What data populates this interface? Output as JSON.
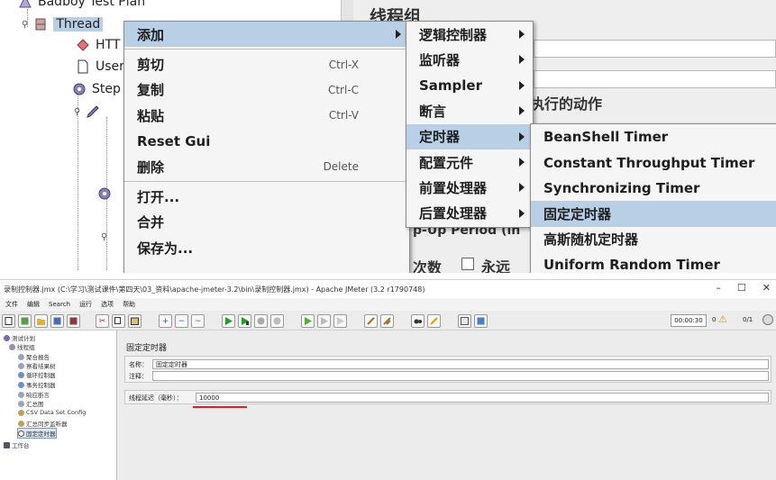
{
  "top": {
    "tree": {
      "plan": "Badboy Test Plan",
      "thread": "Thread",
      "http": "HTT",
      "user": "User",
      "step": "Step"
    },
    "right_title": "线程组",
    "right_action_label": "执行的动作",
    "rampup_label": "p-Up Period (in",
    "loop_label": "次数",
    "forever_label": "永远",
    "menu1": {
      "add": "添加",
      "cut": "剪切",
      "cut_key": "Ctrl-X",
      "copy": "复制",
      "copy_key": "Ctrl-C",
      "paste": "粘贴",
      "paste_key": "Ctrl-V",
      "reset_gui": "Reset Gui",
      "delete": "删除",
      "delete_key": "Delete",
      "open": "打开...",
      "merge": "合并",
      "save_as": "保存为..."
    },
    "menu2": {
      "logic": "逻辑控制器",
      "listener": "监听器",
      "sampler": "Sampler",
      "assertion": "断言",
      "timer": "定时器",
      "config": "配置元件",
      "pre": "前置处理器",
      "post": "后置处理器"
    },
    "menu3": {
      "beanshell": "BeanShell Timer",
      "constant_throughput": "Constant Throughput Timer",
      "synchronizing": "Synchronizing Timer",
      "fixed": "固定定时器",
      "gaussian": "高斯随机定时器",
      "uniform": "Uniform Random Timer"
    }
  },
  "bottom": {
    "window_title": "录制控制器.jmx (C:\\学习\\测试课件\\第四天\\03_资料\\apache-jmeter-3.2\\bin\\录制控制器.jmx) - Apache JMeter (3.2 r1790748)",
    "win_min": "–",
    "win_max": "☐",
    "win_close": "✕",
    "menu": [
      "文件",
      "编辑",
      "Search",
      "运行",
      "选项",
      "帮助"
    ],
    "timer_display": "00:00:30",
    "warn_count": "0",
    "thread_count": "0/1",
    "tree": {
      "plan": "测试计划",
      "group": "线程组",
      "items": [
        "聚合报告",
        "察看结果树",
        "循环控制器",
        "事务控制器",
        "响应断言",
        "汇总图",
        "CSV Data Set Config",
        "汇总同步监听器",
        "固定定时器"
      ],
      "workbench": "工作台"
    },
    "panel_title": "固定定时器",
    "name_label": "名称：",
    "name_value": "固定定时器",
    "comment_label": "注释：",
    "delay_label": "线程延迟（毫秒）：",
    "delay_value": "10000"
  }
}
